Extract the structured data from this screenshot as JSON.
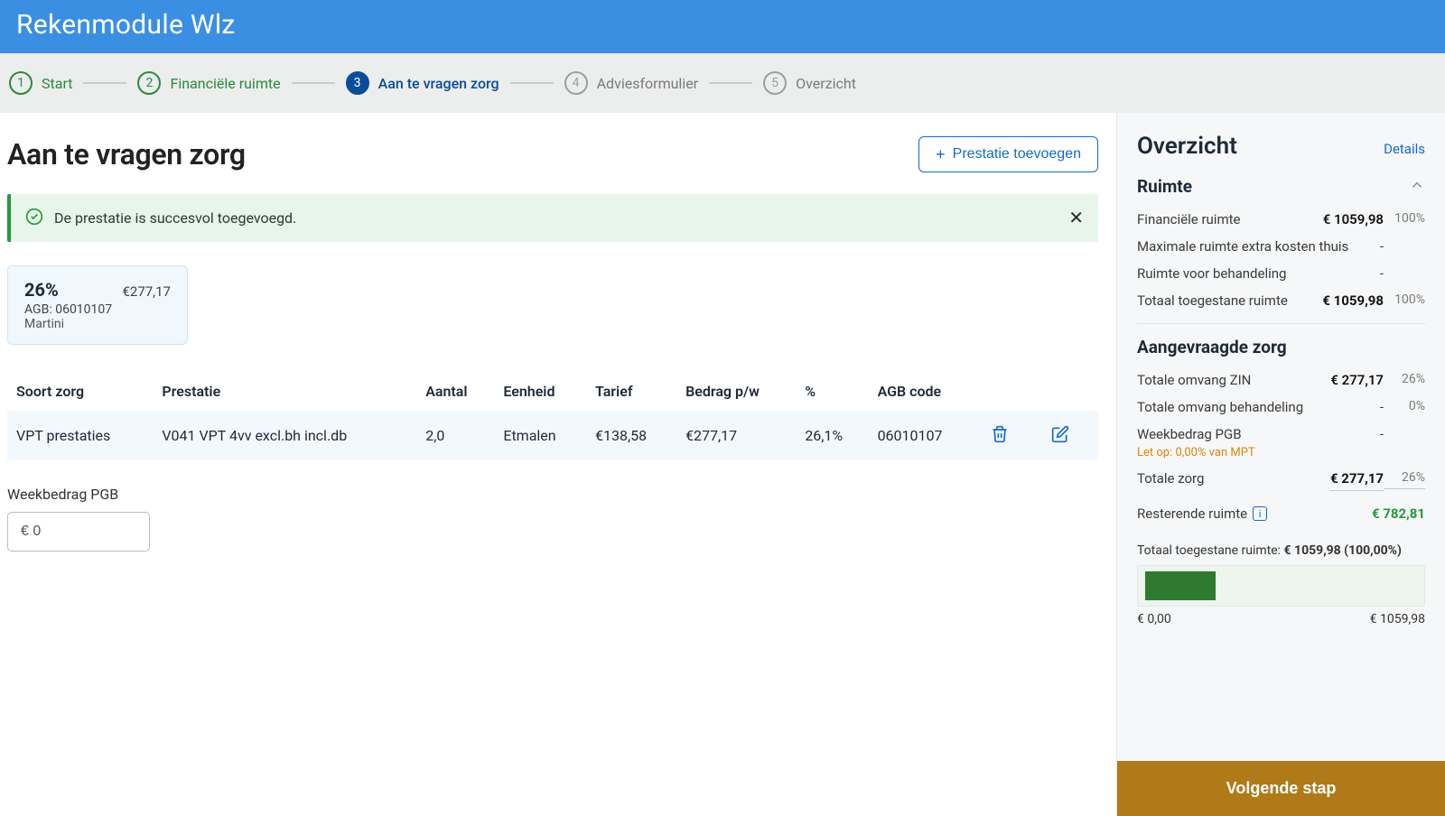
{
  "header": {
    "title": "Rekenmodule Wlz"
  },
  "wizard": {
    "steps": [
      {
        "num": "1",
        "label": "Start",
        "state": "done"
      },
      {
        "num": "2",
        "label": "Financiële ruimte",
        "state": "done"
      },
      {
        "num": "3",
        "label": "Aan te vragen zorg",
        "state": "active"
      },
      {
        "num": "4",
        "label": "Adviesformulier",
        "state": "pending"
      },
      {
        "num": "5",
        "label": "Overzicht",
        "state": "pending"
      }
    ]
  },
  "main": {
    "title": "Aan te vragen zorg",
    "add_button": "Prestatie toevoegen",
    "alert": "De prestatie is succesvol toegevoegd.",
    "card": {
      "pct": "26%",
      "amount": "€277,17",
      "agb_label": "AGB:",
      "agb_code": "06010107",
      "provider": "Martini"
    },
    "table": {
      "headers": {
        "soort": "Soort zorg",
        "prestatie": "Prestatie",
        "aantal": "Aantal",
        "eenheid": "Eenheid",
        "tarief": "Tarief",
        "bedrag": "Bedrag p/w",
        "pct": "%",
        "agb": "AGB code"
      },
      "row": {
        "soort": "VPT prestaties",
        "prestatie": "V041 VPT 4vv excl.bh incl.db",
        "aantal": "2,0",
        "eenheid": "Etmalen",
        "tarief": "€138,58",
        "bedrag": "€277,17",
        "pct": "26,1%",
        "agb": "06010107"
      }
    },
    "pgb": {
      "label": "Weekbedrag PGB",
      "value": "€ 0"
    }
  },
  "side": {
    "title": "Overzicht",
    "details": "Details",
    "ruimte": {
      "heading": "Ruimte",
      "rows": [
        {
          "k": "Financiële ruimte",
          "v": "€ 1059,98",
          "p": "100%"
        },
        {
          "k": "Maximale ruimte extra kosten thuis",
          "v": "-",
          "p": ""
        },
        {
          "k": "Ruimte voor behandeling",
          "v": "-",
          "p": ""
        },
        {
          "k": "Totaal toegestane ruimte",
          "v": "€ 1059,98",
          "p": "100%",
          "bold": true
        }
      ]
    },
    "aangevraagd": {
      "heading": "Aangevraagde zorg",
      "rows": [
        {
          "k": "Totale omvang ZIN",
          "v": "€ 277,17",
          "p": "26%"
        },
        {
          "k": "Totale omvang behandeling",
          "v": "-",
          "p": "0%"
        },
        {
          "k": "Weekbedrag PGB",
          "v": "-",
          "p": "",
          "warn": "Let op: 0,00% van MPT"
        },
        {
          "k": "Totale zorg",
          "v": "€ 277,17",
          "p": "26%",
          "underline": true
        }
      ]
    },
    "remaining": {
      "label": "Resterende ruimte",
      "value": "€ 782,81"
    },
    "bar": {
      "caption_prefix": "Totaal toegestane ruimte: ",
      "caption_value": "€ 1059,98 (100,00%)",
      "fill_pct": 26,
      "min": "€ 0,00",
      "max": "€ 1059,98"
    },
    "next": "Volgende stap"
  },
  "chart_data": {
    "type": "bar",
    "title": "Totaal toegestane ruimte: € 1059,98 (100,00%)",
    "categories": [
      "Totale zorg"
    ],
    "values": [
      277.17
    ],
    "xlim": [
      0,
      1059.98
    ],
    "xlabel": "€",
    "ylabel": ""
  }
}
